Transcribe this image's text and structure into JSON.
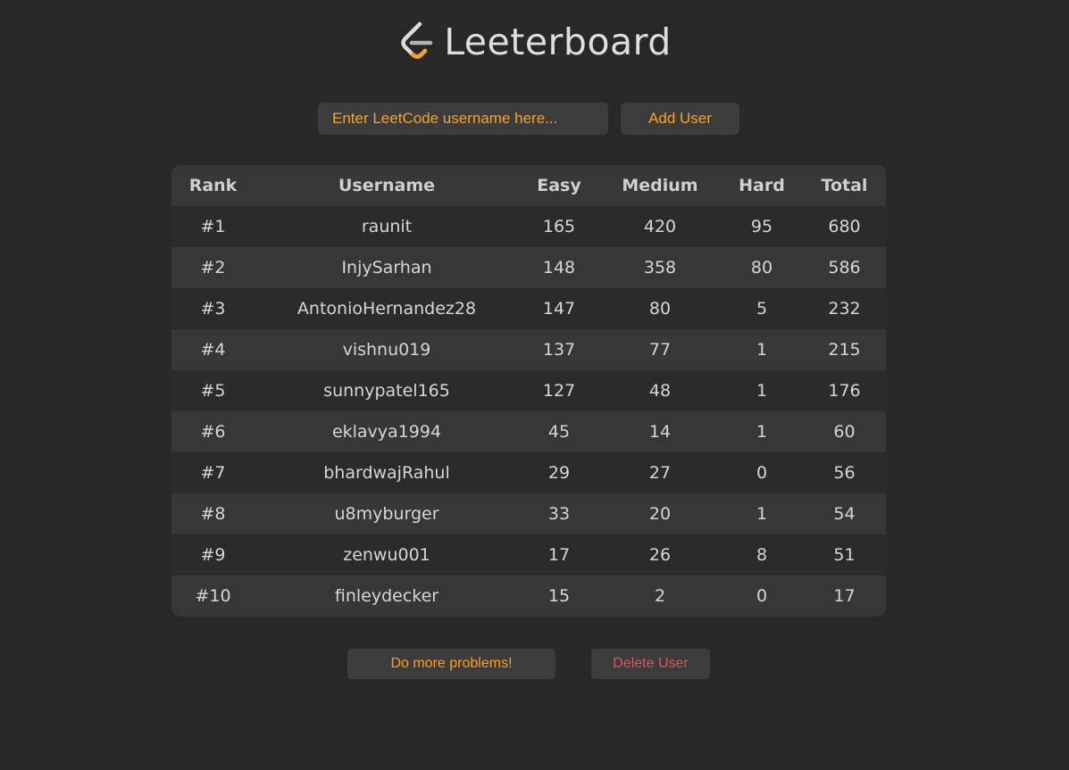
{
  "header": {
    "title": "Leeterboard",
    "logo_icon": "leetcode-logo-icon"
  },
  "add_user": {
    "placeholder": "Enter LeetCode username here...",
    "value": "",
    "button_label": "Add User"
  },
  "table": {
    "columns": [
      "Rank",
      "Username",
      "Easy",
      "Medium",
      "Hard",
      "Total"
    ],
    "rows": [
      {
        "rank": "#1",
        "username": "raunit",
        "easy": "165",
        "medium": "420",
        "hard": "95",
        "total": "680"
      },
      {
        "rank": "#2",
        "username": "InjySarhan",
        "easy": "148",
        "medium": "358",
        "hard": "80",
        "total": "586"
      },
      {
        "rank": "#3",
        "username": "AntonioHernandez28",
        "easy": "147",
        "medium": "80",
        "hard": "5",
        "total": "232"
      },
      {
        "rank": "#4",
        "username": "vishnu019",
        "easy": "137",
        "medium": "77",
        "hard": "1",
        "total": "215"
      },
      {
        "rank": "#5",
        "username": "sunnypatel165",
        "easy": "127",
        "medium": "48",
        "hard": "1",
        "total": "176"
      },
      {
        "rank": "#6",
        "username": "eklavya1994",
        "easy": "45",
        "medium": "14",
        "hard": "1",
        "total": "60"
      },
      {
        "rank": "#7",
        "username": "bhardwajRahul",
        "easy": "29",
        "medium": "27",
        "hard": "0",
        "total": "56"
      },
      {
        "rank": "#8",
        "username": "u8myburger",
        "easy": "33",
        "medium": "20",
        "hard": "1",
        "total": "54"
      },
      {
        "rank": "#9",
        "username": "zenwu001",
        "easy": "17",
        "medium": "26",
        "hard": "8",
        "total": "51"
      },
      {
        "rank": "#10",
        "username": "finleydecker",
        "easy": "15",
        "medium": "2",
        "hard": "0",
        "total": "17"
      }
    ]
  },
  "footer": {
    "more_problems_label": "Do more problems!",
    "delete_label": "Delete User"
  },
  "colors": {
    "background": "#282828",
    "accent": "#ffa116",
    "danger": "#e0555a",
    "row_alt": "#373737"
  }
}
